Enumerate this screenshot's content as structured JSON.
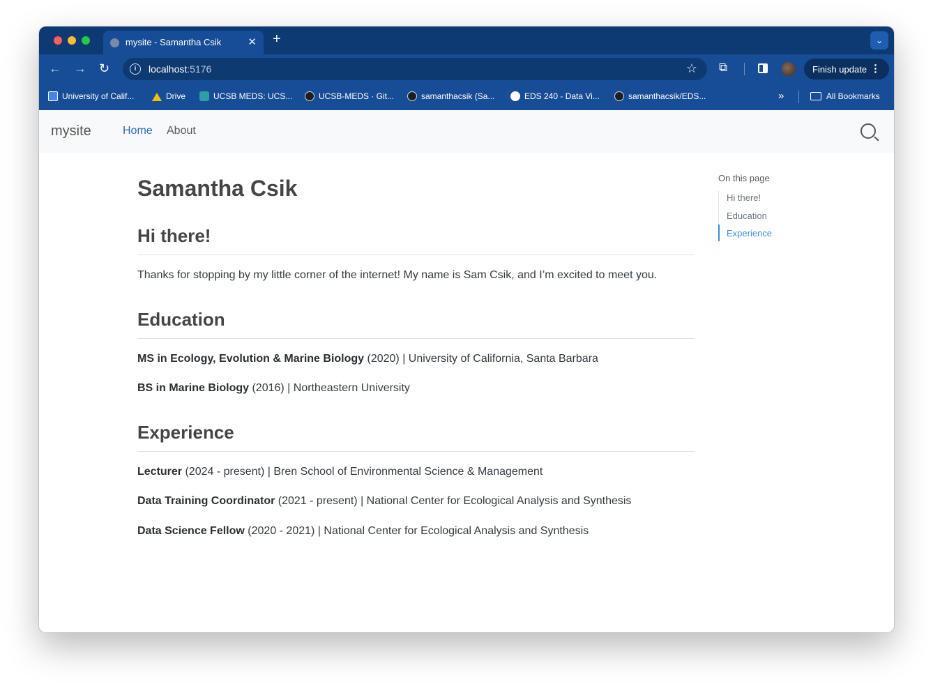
{
  "browser": {
    "tab_title": "mysite - Samantha Csik",
    "new_tab": "+",
    "tab_close": "✕",
    "tab_menu": "⌄",
    "url_host": "localhost",
    "url_port": ":5176",
    "finish_update": "Finish update",
    "menu_dots": "⋮",
    "back": "←",
    "forward": "→",
    "reload": "↻",
    "star": "☆",
    "extensions": "⧉"
  },
  "bookmarks": [
    {
      "label": "University of Calif...",
      "icon": "calendar-icon"
    },
    {
      "label": "Drive",
      "icon": "drive-icon"
    },
    {
      "label": "UCSB MEDS: UCS...",
      "icon": "meds-icon"
    },
    {
      "label": "UCSB-MEDS · Git...",
      "icon": "github-icon"
    },
    {
      "label": "samanthacsik (Sa...",
      "icon": "github-icon"
    },
    {
      "label": "EDS 240 - Data Vi...",
      "icon": "globe-icon"
    },
    {
      "label": "samanthacsik/EDS...",
      "icon": "github-icon"
    }
  ],
  "bookmarks_more": "»",
  "all_bookmarks": "All Bookmarks",
  "site": {
    "brand": "mysite",
    "nav": [
      "Home",
      "About"
    ]
  },
  "main": {
    "title": "Samantha Csik",
    "hi_heading": "Hi there!",
    "hi_text": "Thanks for stopping by my little corner of the internet! My name is Sam Csik, and I’m excited to meet you.",
    "education_heading": "Education",
    "education": [
      {
        "degree": "MS in Ecology, Evolution & Marine Biology",
        "detail": " (2020) | University of California, Santa Barbara"
      },
      {
        "degree": "BS in Marine Biology",
        "detail": " (2016) | Northeastern University"
      }
    ],
    "experience_heading": "Experience",
    "experience": [
      {
        "role": "Lecturer",
        "detail": " (2024 - present) | Bren School of Environmental Science & Management"
      },
      {
        "role": "Data Training Coordinator",
        "detail": " (2021 - present) | National Center for Ecological Analysis and Synthesis"
      },
      {
        "role": "Data Science Fellow",
        "detail": " (2020 - 2021) | National Center for Ecological Analysis and Synthesis"
      }
    ]
  },
  "toc": {
    "title": "On this page",
    "items": [
      "Hi there!",
      "Education",
      "Experience"
    ],
    "active": "Experience"
  },
  "colors": {
    "chrome_dark": "#0d3a73",
    "chrome": "#174d96",
    "link_active": "#2a6bba",
    "toc_active": "#3b8bd9"
  }
}
